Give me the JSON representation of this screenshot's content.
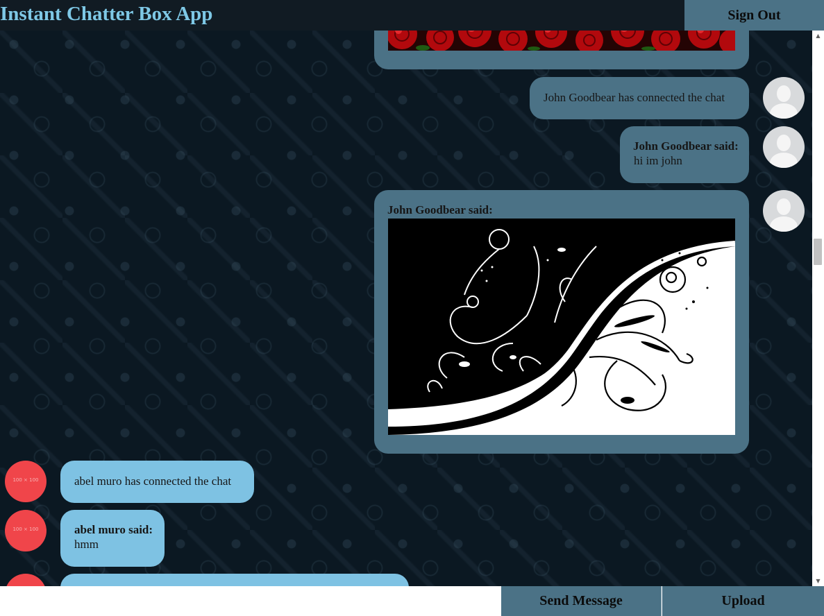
{
  "header": {
    "title": "Instant Chatter Box App",
    "sign_out_label": "Sign Out"
  },
  "messages": [
    {
      "side": "right",
      "type": "image",
      "image": "red-roses"
    },
    {
      "side": "right",
      "type": "status",
      "text": "John Goodbear has connected the chat",
      "avatar": "default-user-icon"
    },
    {
      "side": "right",
      "type": "text",
      "sender": "John Goodbear said:",
      "text": "hi im john",
      "avatar": "default-user-icon"
    },
    {
      "side": "right",
      "type": "image",
      "sender": "John Goodbear said:",
      "image": "black-white-floral-swirl",
      "avatar": "default-user-icon"
    },
    {
      "side": "left",
      "type": "status",
      "text": "abel muro has connected the chat",
      "avatar_text": "100 × 100"
    },
    {
      "side": "left",
      "type": "text",
      "sender": "abel muro said:",
      "text": "hmm",
      "avatar_text": "100 × 100"
    },
    {
      "side": "left",
      "type": "partial",
      "avatar_text": ""
    }
  ],
  "composer": {
    "input_value": "",
    "send_label": "Send Message",
    "upload_label": "Upload"
  },
  "scrollbar": {
    "up_arrow": "▲",
    "down_arrow": "▼"
  },
  "colors": {
    "header_bg": "#111b23",
    "title": "#7ec8e6",
    "button_bg": "#4b7286",
    "right_bubble": "#4b7286",
    "left_bubble": "#7ec2e3",
    "red_avatar": "#f0454a"
  }
}
